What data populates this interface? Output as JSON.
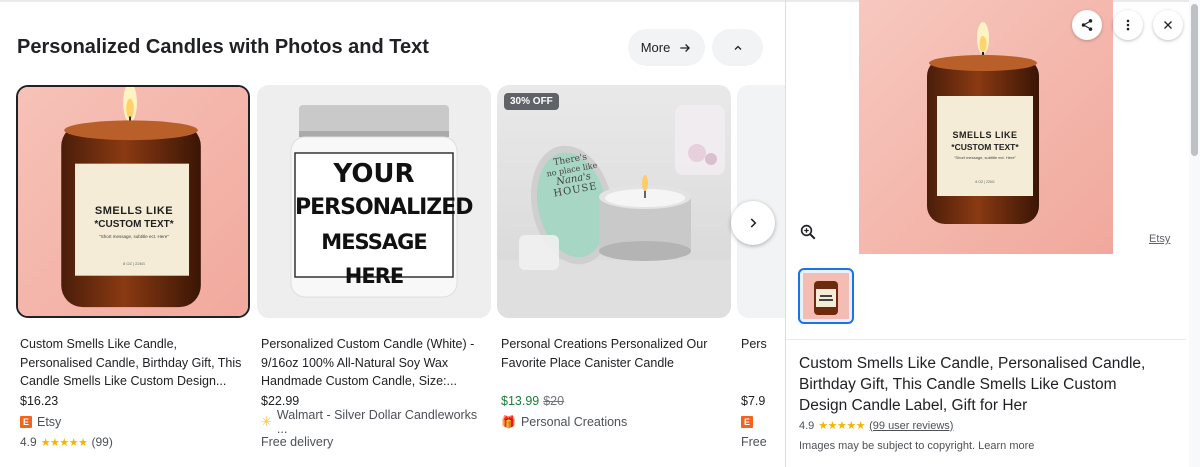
{
  "section": {
    "title": "Personalized Candles with Photos and Text",
    "more_label": "More"
  },
  "products": [
    {
      "title": "Custom Smells Like Candle, Personalised Candle, Birthday Gift, This Candle Smells Like Custom Design...",
      "price": "$16.23",
      "merchant": "Etsy",
      "rating": "4.9",
      "stars": "★★★★★",
      "reviews": "(99)",
      "image": {
        "label_line1": "SMELLS LIKE",
        "label_line2": "*CUSTOM TEXT*",
        "label_line3": "\"Short message, subtitle ect. Here\"",
        "label_line4": "8 OZ | 226G"
      }
    },
    {
      "title": "Personalized Custom Candle (White) - 9/16oz 100% All-Natural Soy Wax Handmade Custom Candle, Size:...",
      "price": "$22.99",
      "merchant": "Walmart - Silver Dollar Candleworks ...",
      "shipping": "Free delivery",
      "image": {
        "line1": "YOUR",
        "line2": "PERSONALIZED",
        "line3": "MESSAGE HERE"
      }
    },
    {
      "title": "Personal Creations Personalized Our Favorite Place Canister Candle",
      "sale_price": "$13.99",
      "original_price": "$20",
      "merchant": "Personal Creations",
      "badge": "30% OFF",
      "image": {
        "line1": "There's",
        "line2": "no place like",
        "line3": "Nana's",
        "line4": "HOUSE"
      }
    },
    {
      "title": "Pers",
      "price": "$7.9",
      "merchant_initial": "E",
      "shipping": "Free"
    }
  ],
  "detail": {
    "title": "Custom Smells Like Candle, Personalised Candle, Birthday Gift, This Candle Smells Like Custom Design Candle Label, Gift for Her",
    "rating": "4.9",
    "stars": "★★★★★",
    "reviews_link": "(99 user reviews)",
    "source": "Etsy",
    "copyright_note": "Images may be subject to copyright. Learn more",
    "image": {
      "label_line1": "SMELLS LIKE",
      "label_line2": "*CUSTOM TEXT*",
      "label_line3": "\"Short message, subtitle ect. Here\"",
      "label_line4": "8 OZ | 226G"
    }
  },
  "colors": {
    "accent": "#1a73e8",
    "sale_green": "#188038",
    "star": "#f4b400",
    "etsy_orange": "#f1641e",
    "walmart_yellow": "#ffc220"
  }
}
